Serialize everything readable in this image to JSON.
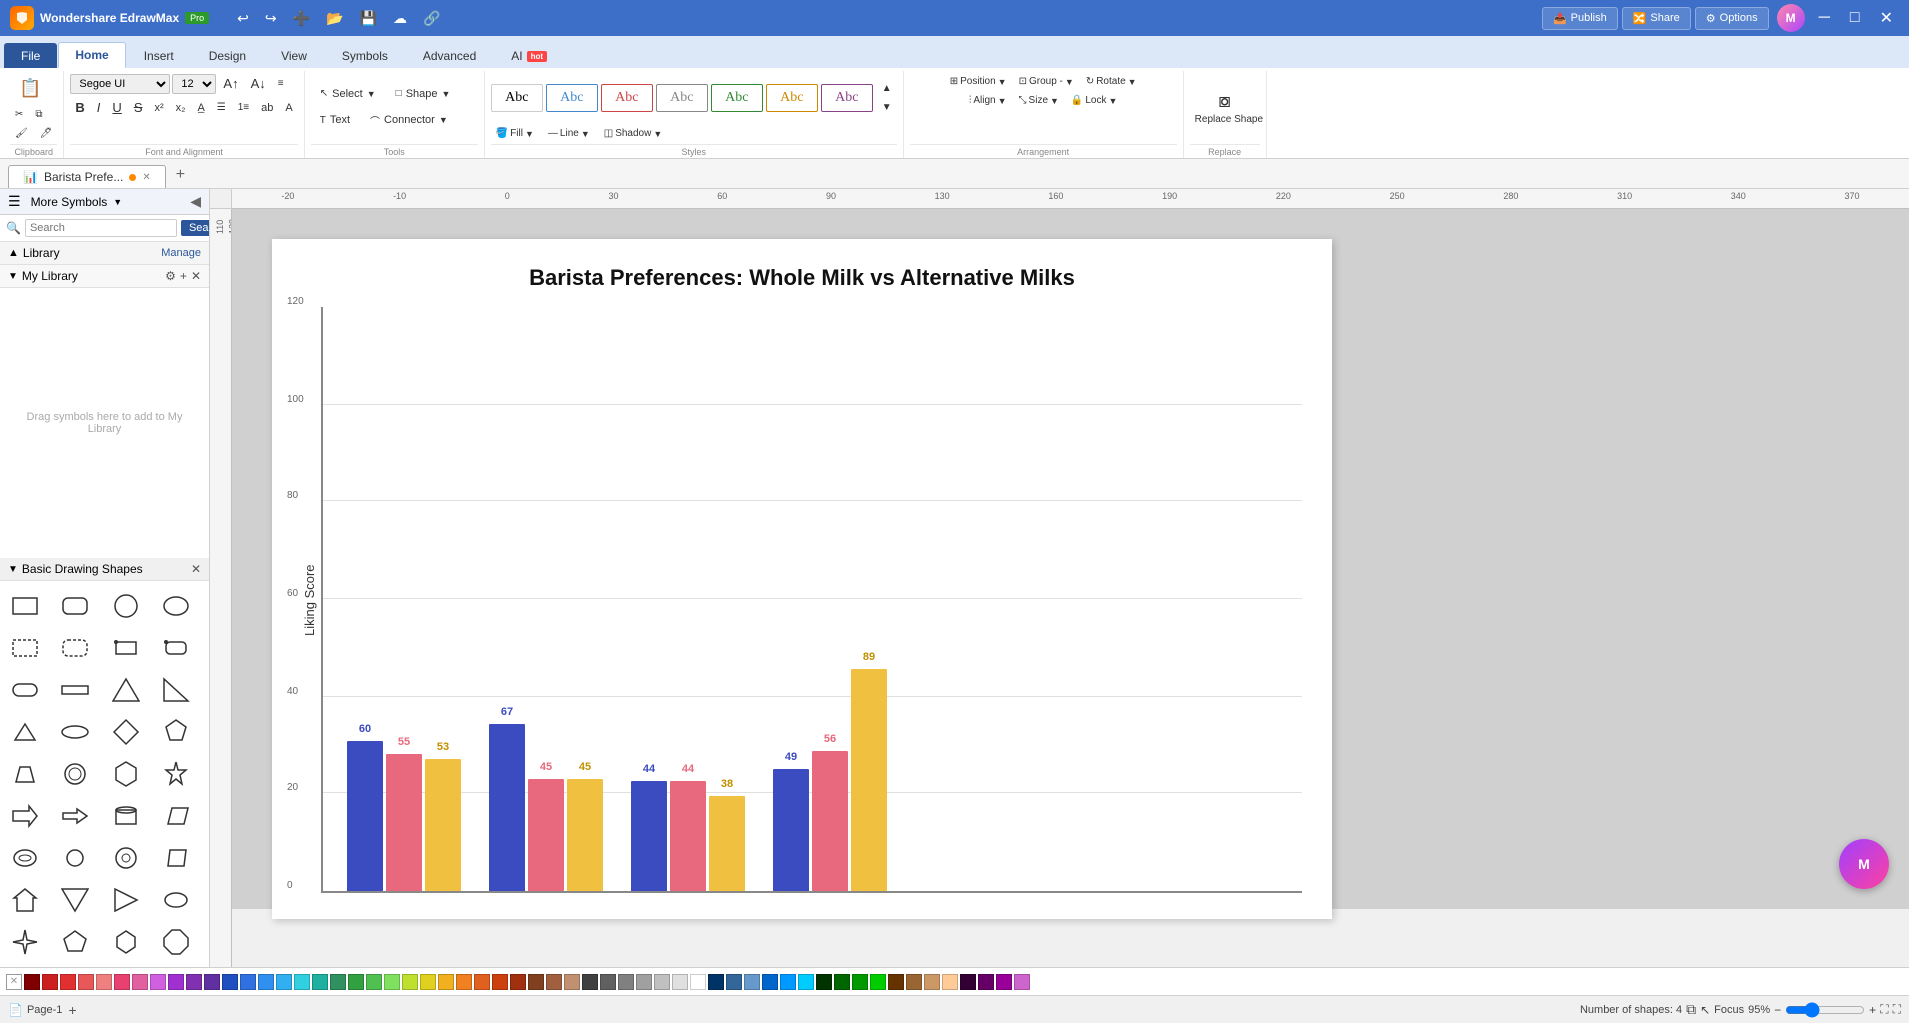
{
  "app": {
    "name": "Wondershare EdrawMax",
    "version": "Pro",
    "title": "Barista Prefe..."
  },
  "tabs": {
    "ribbon": [
      "File",
      "Home",
      "Insert",
      "Design",
      "View",
      "Symbols",
      "Advanced",
      "AI"
    ],
    "active": "Home",
    "ai_badge": "hot"
  },
  "topright": {
    "publish": "Publish",
    "share": "Share",
    "options": "Options"
  },
  "toolbar": {
    "clipboard_label": "Clipboard",
    "font_alignment_label": "Font and Alignment",
    "tools_label": "Tools",
    "styles_label": "Styles",
    "arrangement_label": "Arrangement",
    "replace_label": "Replace",
    "font_name": "Segoe UI",
    "font_size": "12",
    "select_label": "Select",
    "shape_label": "Shape",
    "text_label": "Text",
    "connector_label": "Connector",
    "fill_label": "Fill",
    "line_label": "Line",
    "shadow_label": "Shadow",
    "position_label": "Position",
    "group_label": "Group -",
    "rotate_label": "Rotate",
    "align_label": "Align",
    "size_label": "Size",
    "lock_label": "Lock",
    "replace_shape_label": "Replace Shape"
  },
  "left_panel": {
    "more_symbols": "More Symbols",
    "search_placeholder": "Search",
    "search_btn": "Search",
    "library": "Library",
    "manage": "Manage",
    "my_library": "My Library",
    "drag_text": "Drag symbols here to add to My Library",
    "basic_drawing_shapes": "Basic Drawing Shapes"
  },
  "document": {
    "tab_name": "Barista Prefe...",
    "unsaved": true,
    "page_name": "Page-1"
  },
  "chart": {
    "title": "Barista Preferences: Whole Milk vs Alternative Milks",
    "y_label": "Liking Score",
    "y_max": 120,
    "y_ticks": [
      0,
      20,
      40,
      60,
      80,
      100,
      120
    ],
    "groups": [
      {
        "bars": [
          {
            "color": "blue",
            "value": 60,
            "label": "60"
          },
          {
            "color": "red",
            "value": 55,
            "label": "55"
          },
          {
            "color": "yellow",
            "value": 53,
            "label": "53"
          }
        ]
      },
      {
        "bars": [
          {
            "color": "blue",
            "value": 67,
            "label": "67"
          },
          {
            "color": "red",
            "value": 45,
            "label": "45"
          },
          {
            "color": "yellow",
            "value": 45,
            "label": "45"
          }
        ]
      },
      {
        "bars": [
          {
            "color": "blue",
            "value": 44,
            "label": "44"
          },
          {
            "color": "red",
            "value": 44,
            "label": "44"
          },
          {
            "color": "yellow",
            "value": 38,
            "label": "38"
          }
        ]
      },
      {
        "bars": [
          {
            "color": "blue",
            "value": 49,
            "label": "49"
          },
          {
            "color": "red",
            "value": 56,
            "label": "56"
          },
          {
            "color": "yellow",
            "value": 89,
            "label": "89"
          }
        ]
      }
    ]
  },
  "statusbar": {
    "page_label": "Page-1",
    "shape_count": "Number of shapes: 4",
    "focus": "Focus",
    "zoom": "95%"
  },
  "colors": [
    "#cc2020",
    "#e03030",
    "#e85858",
    "#f08080",
    "#e84070",
    "#e060a0",
    "#d060e0",
    "#a030d0",
    "#8030b0",
    "#6030a0",
    "#2050c0",
    "#3070e0",
    "#3090f0",
    "#30b0f0",
    "#30d0e0",
    "#20b0a0",
    "#309060",
    "#30a040",
    "#50c050",
    "#80e060",
    "#c0e030",
    "#e0d020",
    "#f0b020",
    "#f08020",
    "#e06020",
    "#cc4010",
    "#a03010",
    "#804020",
    "#a06040",
    "#c09070",
    "#404040",
    "#606060",
    "#808080",
    "#a0a0a0",
    "#c0c0c0",
    "#e0e0e0",
    "#ffffff"
  ],
  "shapes": [
    "rect",
    "rounded-rect",
    "circle",
    "oval",
    "rect-dashed",
    "rounded-rect-dashed",
    "rect-outline",
    "rect-rounded-outline",
    "stadium",
    "wide-rect",
    "triangle",
    "right-triangle",
    "triangle-sm",
    "wide-oval",
    "diamond",
    "pentagon",
    "trapezoid",
    "circle-outline",
    "hexagon",
    "star",
    "arrow-right",
    "arrow-right-sm",
    "arrow-left",
    "curved",
    "cylinder",
    "ring",
    "circle-sm",
    "parallelogram",
    "house",
    "triangle-down",
    "triangle-right",
    "blob",
    "star-4",
    "pentagon-sm",
    "hexagon-sm",
    "octagon"
  ]
}
